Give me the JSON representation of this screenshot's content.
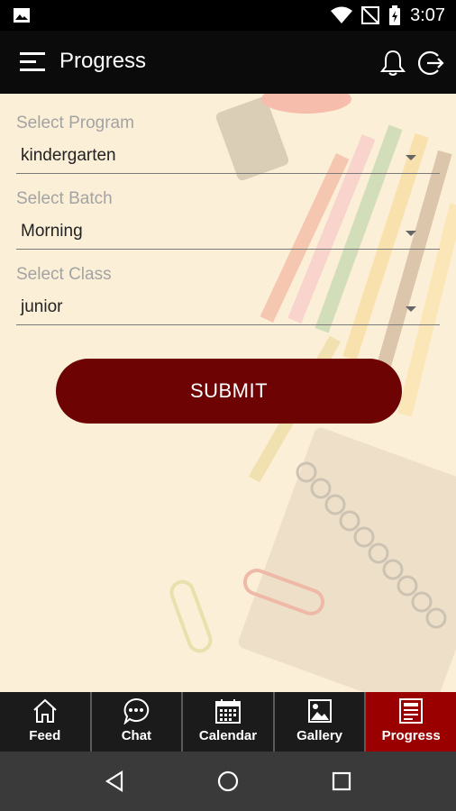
{
  "status_bar": {
    "time": "3:07"
  },
  "app_bar": {
    "title": "Progress"
  },
  "form": {
    "program": {
      "label": "Select Program",
      "value": "kindergarten"
    },
    "batch": {
      "label": "Select Batch",
      "value": "Morning"
    },
    "class": {
      "label": "Select Class",
      "value": "junior"
    },
    "submit_label": "SUBMIT"
  },
  "bottom_nav": {
    "items": [
      {
        "label": "Feed",
        "icon": "home-icon"
      },
      {
        "label": "Chat",
        "icon": "chat-bubble-icon"
      },
      {
        "label": "Calendar",
        "icon": "calendar-icon"
      },
      {
        "label": "Gallery",
        "icon": "gallery-icon"
      },
      {
        "label": "Progress",
        "icon": "report-icon"
      }
    ],
    "active": "Progress"
  },
  "colors": {
    "accent": "#6d0303",
    "active_tab": "#9b0000",
    "background": "#fcefd8"
  }
}
